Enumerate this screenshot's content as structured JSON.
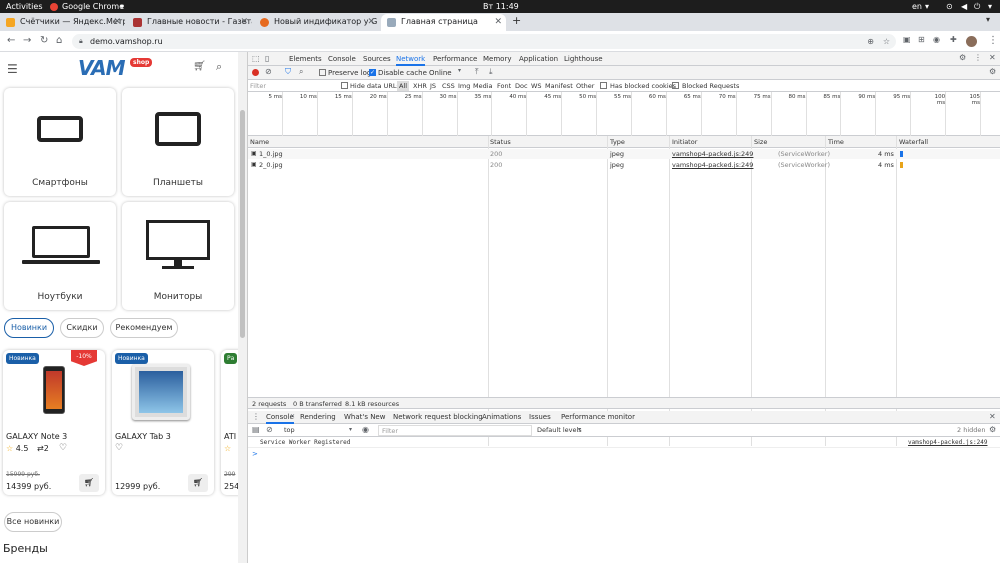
{
  "system": {
    "activities": "Activities",
    "app": "Google Chrome",
    "clock": "Вт 11:49",
    "lang": "en"
  },
  "tabs": [
    {
      "title": "Счётчики — Яндекс.Метр",
      "color": "#f5a623"
    },
    {
      "title": "Главные новости - Газета",
      "color": "#a33"
    },
    {
      "title": "Новый индификатор у G",
      "color": "#e66a1f"
    },
    {
      "title": "Главная страница",
      "color": "#9ab"
    }
  ],
  "address": {
    "url": "demo.vamshop.ru"
  },
  "page": {
    "logo": "VAM",
    "logo_sub": "shop",
    "categories": [
      "Смартфоны",
      "Планшеты",
      "Ноутбуки",
      "Мониторы"
    ],
    "filters": [
      "Новинки",
      "Скидки",
      "Рекомендуем"
    ],
    "products": [
      {
        "badge": "Новинка",
        "discount": "-10%",
        "name": "GALAXY Note 3",
        "rating": "4.5",
        "compare": "2",
        "old_price": "15999 руб.",
        "price": "14399 руб."
      },
      {
        "badge": "Новинка",
        "name": "GALAXY Tab 3",
        "price": "12999 руб."
      },
      {
        "badge": "Ра",
        "name": "ATI",
        "old_price": "299",
        "price": "254"
      }
    ],
    "all_new": "Все новинки",
    "brands": "Бренды"
  },
  "devtools": {
    "tabs": [
      "Elements",
      "Console",
      "Sources",
      "Network",
      "Performance",
      "Memory",
      "Application",
      "Lighthouse"
    ],
    "preserve_log": "Preserve log",
    "disable_cache": "Disable cache",
    "throttle": "Online",
    "filter_placeholder": "Filter",
    "hide_data_urls": "Hide data URLs",
    "types": [
      "All",
      "XHR",
      "JS",
      "CSS",
      "Img",
      "Media",
      "Font",
      "Doc",
      "WS",
      "Manifest",
      "Other"
    ],
    "has_blocked": "Has blocked cookies",
    "blocked_requests": "Blocked Requests",
    "ticks": [
      "5 ms",
      "10 ms",
      "15 ms",
      "20 ms",
      "25 ms",
      "30 ms",
      "35 ms",
      "40 ms",
      "45 ms",
      "50 ms",
      "55 ms",
      "60 ms",
      "65 ms",
      "70 ms",
      "75 ms",
      "80 ms",
      "85 ms",
      "90 ms",
      "95 ms",
      "100 ms",
      "105 ms",
      "11"
    ],
    "columns": [
      "Name",
      "Status",
      "Type",
      "Initiator",
      "Size",
      "Time",
      "Waterfall"
    ],
    "rows": [
      {
        "name": "1_0.jpg",
        "status": "200",
        "type": "jpeg",
        "initiator": "vamshop4-packed.js:249",
        "size": "(ServiceWorker)",
        "time": "4 ms"
      },
      {
        "name": "2_0.jpg",
        "status": "200",
        "type": "jpeg",
        "initiator": "vamshop4-packed.js:249",
        "size": "(ServiceWorker)",
        "time": "4 ms"
      }
    ],
    "summary": [
      "2 requests",
      "0 B transferred",
      "8.1 kB resources"
    ],
    "drawer_tabs": [
      "Console",
      "Rendering",
      "What's New",
      "Network request blocking",
      "Animations",
      "Issues",
      "Performance monitor"
    ],
    "context": "top",
    "console_filter": "Filter",
    "levels": "Default levels",
    "hidden": "2 hidden",
    "log_msg": "Service Worker Registered",
    "log_src": "vamshop4-packed.js:249",
    "prompt": ">"
  }
}
